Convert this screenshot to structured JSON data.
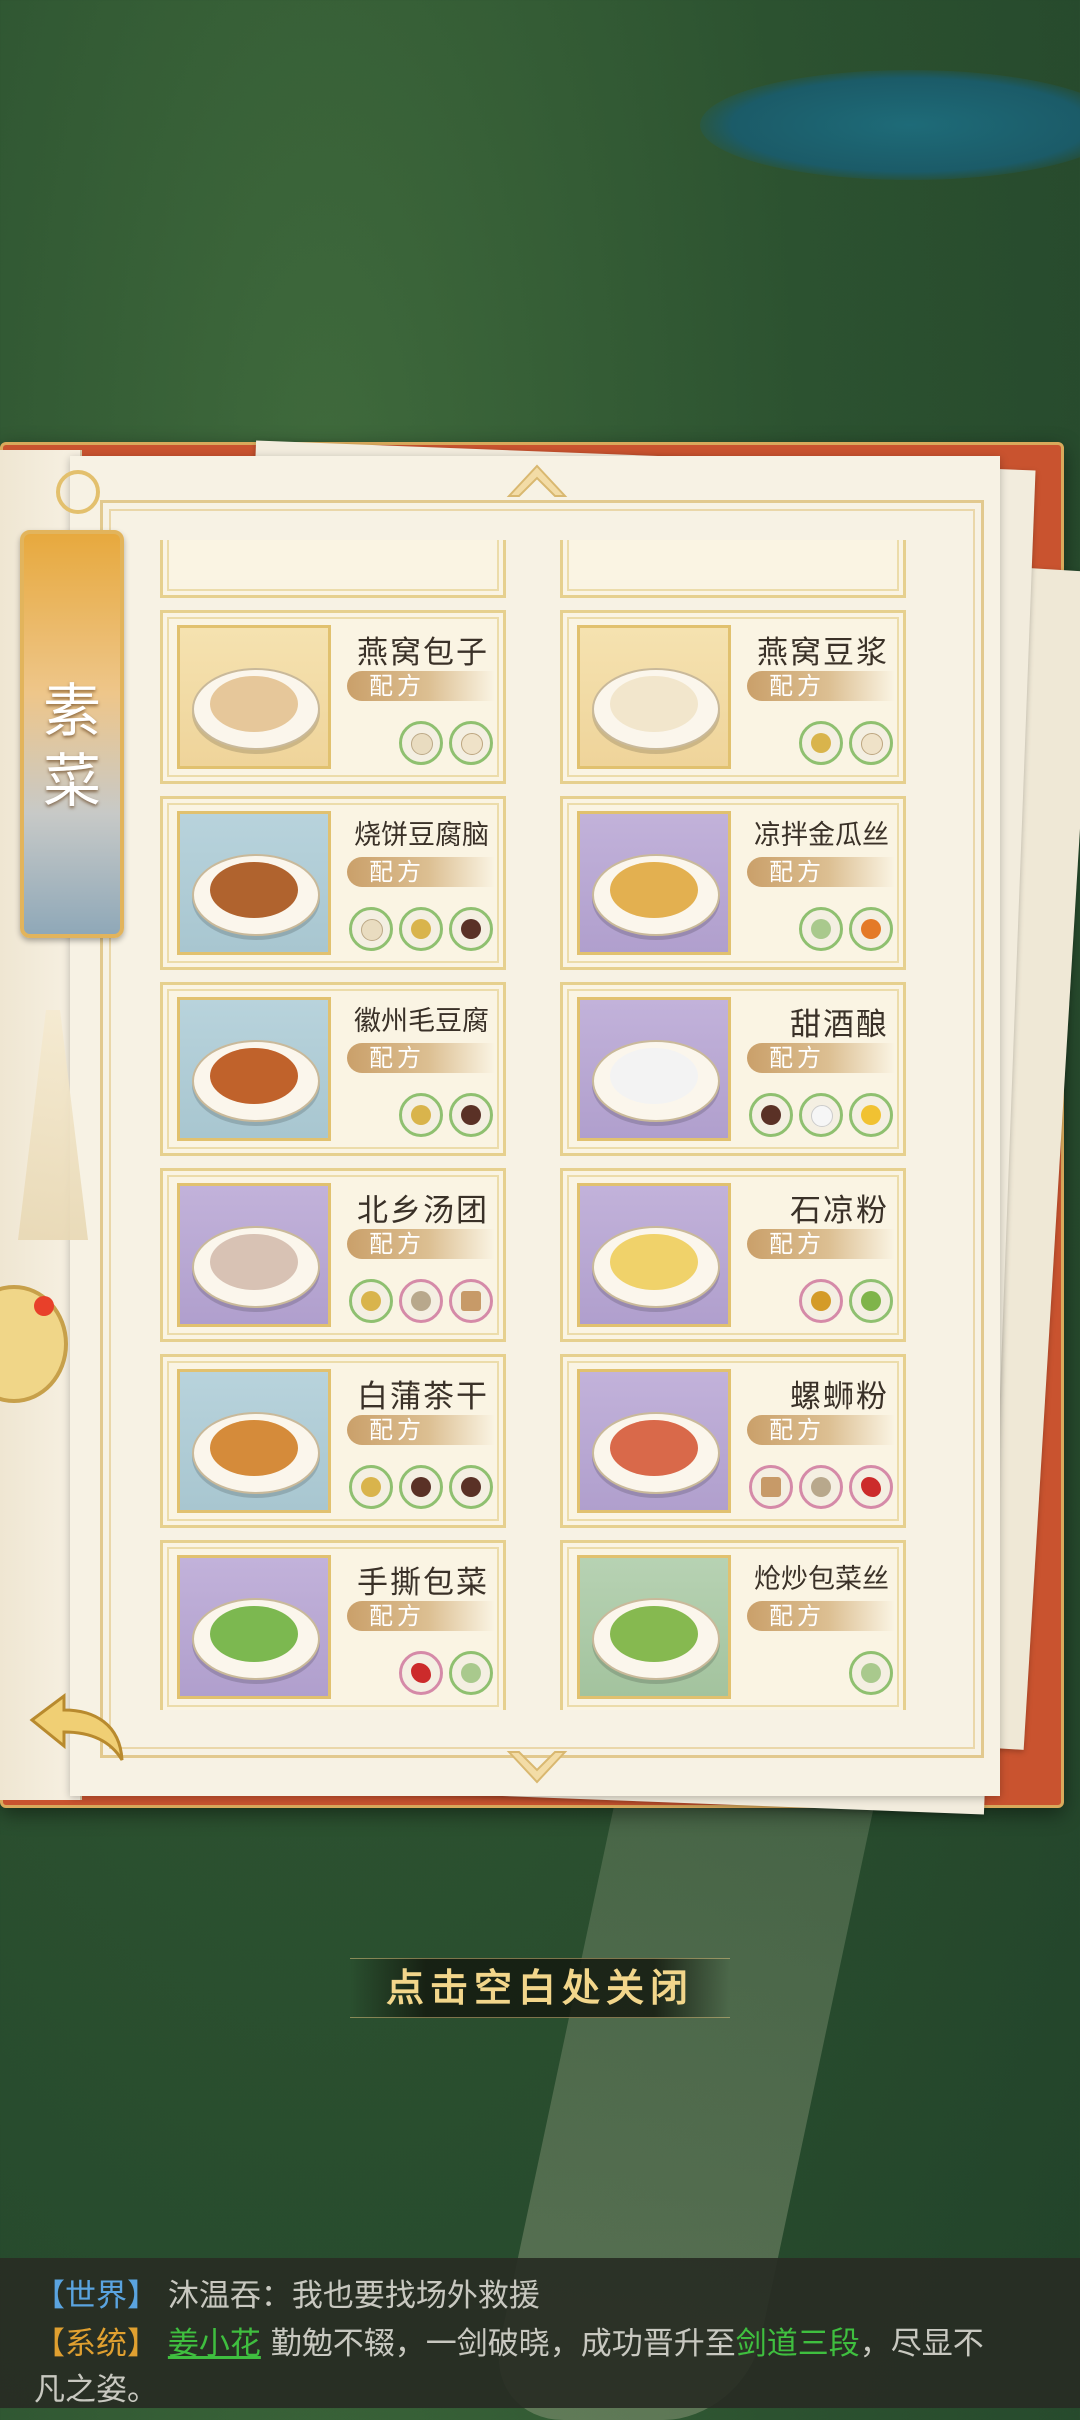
{
  "category_tab": {
    "label_1": "素",
    "label_2": "菜"
  },
  "recipe_tag_label": "配方",
  "cards": [
    {
      "name": "燕窝包子",
      "thumb": "yellow",
      "food_color": "#e6c79a",
      "ingredients": [
        "bun",
        "dumpling"
      ]
    },
    {
      "name": "燕窝豆浆",
      "thumb": "yellow",
      "food_color": "#f2e6cc",
      "ingredients": [
        "grain",
        "dumpling"
      ]
    },
    {
      "name": "烧饼豆腐脑",
      "thumb": "blue",
      "food_color": "#b0632e",
      "ingredients": [
        "bun",
        "grain",
        "jar"
      ]
    },
    {
      "name": "凉拌金瓜丝",
      "thumb": "purple",
      "food_color": "#e3b050",
      "ingredients": [
        "veg",
        "pumpkin"
      ]
    },
    {
      "name": "徽州毛豆腐",
      "thumb": "blue",
      "food_color": "#c0622b",
      "ingredients": [
        "grain",
        "jar"
      ]
    },
    {
      "name": "甜酒酿",
      "thumb": "purple",
      "food_color": "#f3f3f3",
      "ingredients": [
        "jar",
        "egg",
        "flower"
      ]
    },
    {
      "name": "北乡汤团",
      "thumb": "purple",
      "food_color": "#d8c2b4",
      "ingredients": [
        "grain",
        "bowl",
        "stick"
      ]
    },
    {
      "name": "石凉粉",
      "thumb": "purple",
      "food_color": "#f0d26a",
      "ingredients": [
        "seasoning",
        "pea"
      ]
    },
    {
      "name": "白蒲茶干",
      "thumb": "blue",
      "food_color": "#d58b3a",
      "ingredients": [
        "grain",
        "jar",
        "jar"
      ]
    },
    {
      "name": "螺蛳粉",
      "thumb": "purple",
      "food_color": "#d9694a",
      "ingredients": [
        "stick",
        "bowl",
        "chili"
      ]
    },
    {
      "name": "手撕包菜",
      "thumb": "purple",
      "food_color": "#7cb850",
      "ingredients": [
        "chili",
        "veg"
      ]
    },
    {
      "name": "炝炒包菜丝",
      "thumb": "green",
      "food_color": "#86b950",
      "ingredients": [
        "veg"
      ]
    }
  ],
  "close_hint": "点击空白处关闭",
  "chat": {
    "line1": {
      "channel": "【世界】",
      "text": "沐温吞：我也要找场外救援"
    },
    "line2": {
      "channel": "【系统】",
      "name": "姜小花",
      "text_a": "勤勉不辍，一剑破晓，成功晋升至",
      "rank": "剑道三段",
      "text_b": "，尽显不"
    },
    "line3": {
      "text": "凡之姿。"
    }
  }
}
